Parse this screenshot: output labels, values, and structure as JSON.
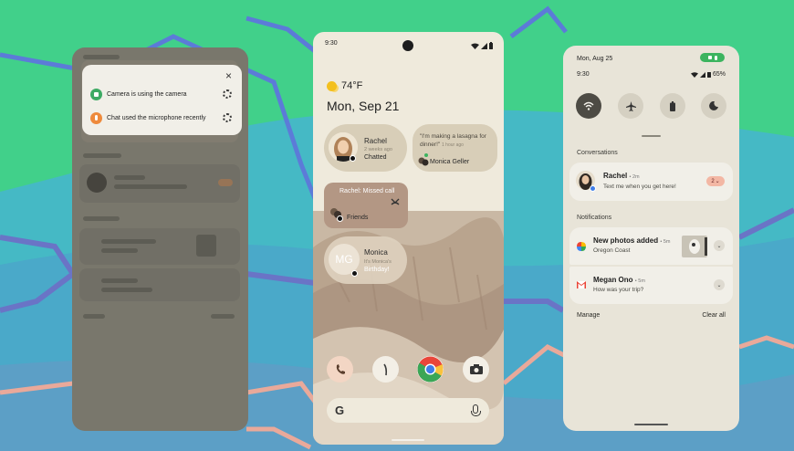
{
  "left_phone": {
    "privacy": {
      "camera_text": "Camera is using the camera",
      "mic_text": "Chat used the microphone recently",
      "close_glyph": "×",
      "camera_icon": "camera-dot-icon",
      "mic_icon": "microphone-dot-icon",
      "colors": {
        "camera": "#3daa63",
        "mic": "#ee8a3c"
      }
    }
  },
  "middle_phone": {
    "status": {
      "time": "9:30"
    },
    "weather": {
      "temp": "74°F",
      "icon": "sunny-icon"
    },
    "date": "Mon, Sep 21",
    "widgets": {
      "rachel": {
        "name": "Rachel",
        "sub": "2 weeks ago",
        "status": "Chatted"
      },
      "quote": {
        "text": "\"I'm making a lasagna for dinner!\"",
        "time": "1 hour ago",
        "name": "Monica Geller"
      },
      "missed": {
        "title": "Rachel: Missed call",
        "label": "Friends"
      },
      "monica": {
        "initials": "MG",
        "name": "Monica",
        "sub": "It's Monica's",
        "status": "Birthday!"
      }
    },
    "dock": [
      "phone-icon",
      "messages-icon",
      "chrome-icon",
      "camera-icon"
    ],
    "search": {
      "g": "G",
      "mic": "mic-icon"
    }
  },
  "right_phone": {
    "status": {
      "date": "Mon, Aug 25",
      "time": "9:30",
      "battery": "65%"
    },
    "tiles": [
      "wifi-icon",
      "airplane-icon",
      "battery-saver-icon",
      "dark-mode-icon"
    ],
    "conversations_label": "Conversations",
    "conversation": {
      "name": "Rachel",
      "time": "2m",
      "message": "Text me when you get here!",
      "count": "2"
    },
    "notifications_label": "Notifications",
    "notifications": [
      {
        "title": "New photos added",
        "time": "5m",
        "body": "Oregon Coast",
        "icon": "photos-icon"
      },
      {
        "title": "Megan Ono",
        "time": "5m",
        "body": "How was your trip?",
        "icon": "gmail-icon"
      }
    ],
    "footer": {
      "manage": "Manage",
      "clear": "Clear all"
    }
  }
}
